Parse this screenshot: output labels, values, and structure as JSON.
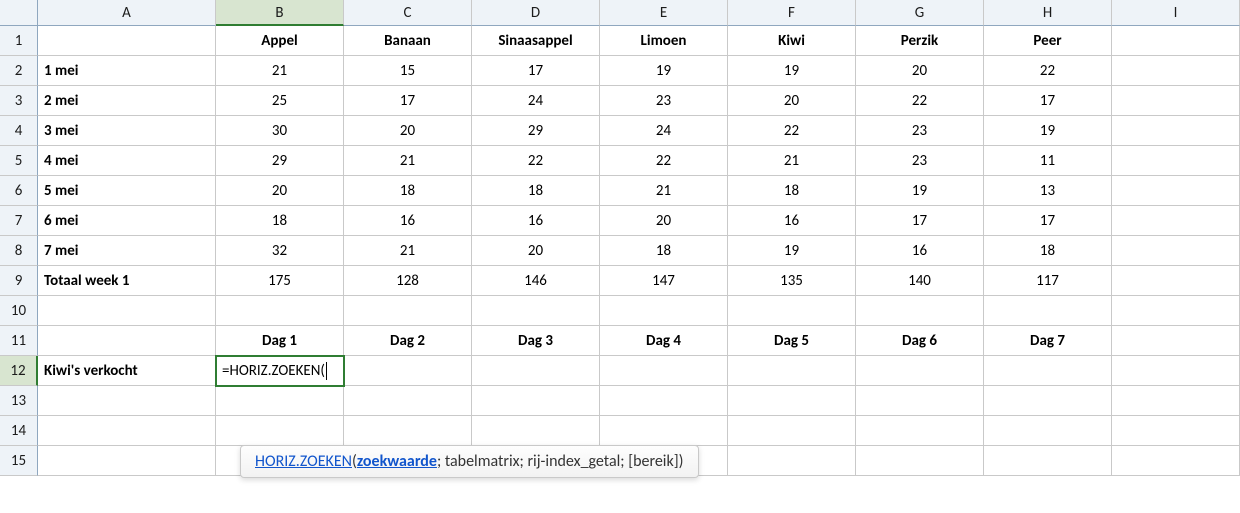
{
  "columns": [
    "A",
    "B",
    "C",
    "D",
    "E",
    "F",
    "G",
    "H",
    "I"
  ],
  "selected_col_index": 1,
  "selected_row_index": 11,
  "row_count": 15,
  "headers_row1": {
    "B": "Appel",
    "C": "Banaan",
    "D": "Sinaasappel",
    "E": "Limoen",
    "F": "Kiwi",
    "G": "Perzik",
    "H": "Peer"
  },
  "data_rows": [
    {
      "A": "1 mei",
      "B": 21,
      "C": 15,
      "D": 17,
      "E": 19,
      "F": 19,
      "G": 20,
      "H": 22
    },
    {
      "A": "2 mei",
      "B": 25,
      "C": 17,
      "D": 24,
      "E": 23,
      "F": 20,
      "G": 22,
      "H": 17
    },
    {
      "A": "3 mei",
      "B": 30,
      "C": 20,
      "D": 29,
      "E": 24,
      "F": 22,
      "G": 23,
      "H": 19
    },
    {
      "A": "4 mei",
      "B": 29,
      "C": 21,
      "D": 22,
      "E": 22,
      "F": 21,
      "G": 23,
      "H": 11
    },
    {
      "A": "5 mei",
      "B": 20,
      "C": 18,
      "D": 18,
      "E": 21,
      "F": 18,
      "G": 19,
      "H": 13
    },
    {
      "A": "6 mei",
      "B": 18,
      "C": 16,
      "D": 16,
      "E": 20,
      "F": 16,
      "G": 17,
      "H": 17
    },
    {
      "A": "7 mei",
      "B": 32,
      "C": 21,
      "D": 20,
      "E": 18,
      "F": 19,
      "G": 16,
      "H": 18
    }
  ],
  "totals_row": {
    "A": "Totaal week 1",
    "B": 175,
    "C": 128,
    "D": 146,
    "E": 147,
    "F": 135,
    "G": 140,
    "H": 117
  },
  "headers_row11": {
    "B": "Dag 1",
    "C": "Dag 2",
    "D": "Dag 3",
    "E": "Dag 4",
    "F": "Dag 5",
    "G": "Dag 6",
    "H": "Dag 7"
  },
  "row12_label": "Kiwi's verkocht",
  "active_formula": "=HORIZ.ZOEKEN(",
  "tooltip": {
    "fn": "HORIZ.ZOEKEN",
    "open": "(",
    "arg_active": "zoekwaarde",
    "rest": "; tabelmatrix; rij-index_getal; [bereik])"
  },
  "chart_data": {
    "type": "table",
    "title": "",
    "categories": [
      "Appel",
      "Banaan",
      "Sinaasappel",
      "Limoen",
      "Kiwi",
      "Perzik",
      "Peer"
    ],
    "rows": [
      "1 mei",
      "2 mei",
      "3 mei",
      "4 mei",
      "5 mei",
      "6 mei",
      "7 mei",
      "Totaal week 1"
    ],
    "values": [
      [
        21,
        15,
        17,
        19,
        19,
        20,
        22
      ],
      [
        25,
        17,
        24,
        23,
        20,
        22,
        17
      ],
      [
        30,
        20,
        29,
        24,
        22,
        23,
        19
      ],
      [
        29,
        21,
        22,
        22,
        21,
        23,
        11
      ],
      [
        20,
        18,
        18,
        21,
        18,
        19,
        13
      ],
      [
        18,
        16,
        16,
        20,
        16,
        17,
        17
      ],
      [
        32,
        21,
        20,
        18,
        19,
        16,
        18
      ],
      [
        175,
        128,
        146,
        147,
        135,
        140,
        117
      ]
    ]
  }
}
